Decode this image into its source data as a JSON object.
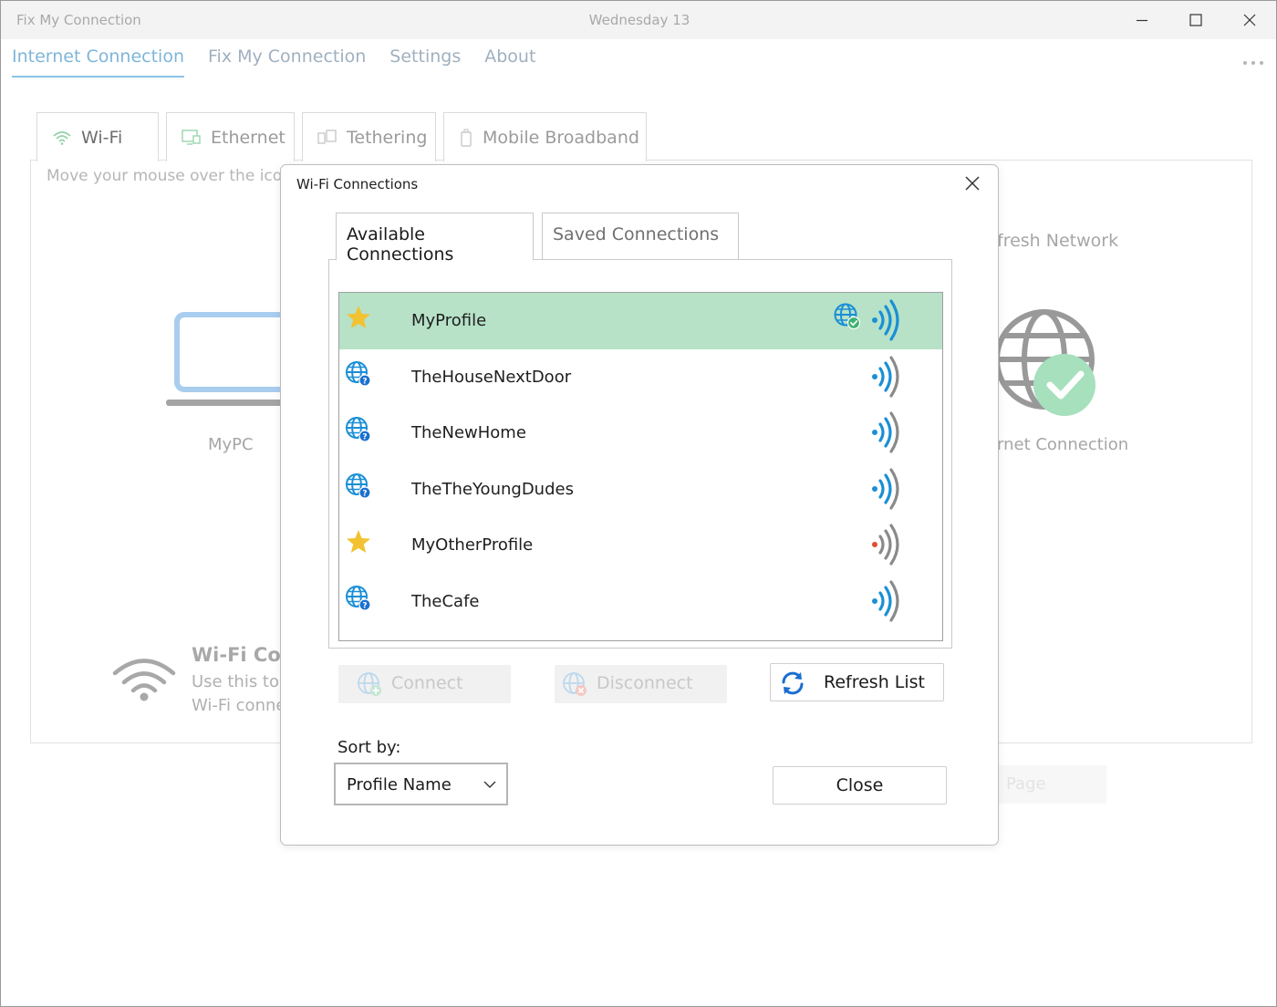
{
  "window": {
    "title": "Fix My Connection",
    "date": "Wednesday 13"
  },
  "nav": {
    "items": [
      {
        "label": "Internet Connection",
        "active": true
      },
      {
        "label": "Fix My Connection",
        "active": false
      },
      {
        "label": "Settings",
        "active": false
      },
      {
        "label": "About",
        "active": false
      }
    ]
  },
  "background": {
    "tabs": [
      {
        "label": "Wi-Fi",
        "icon": "wifi-icon",
        "active": true
      },
      {
        "label": "Ethernet",
        "icon": "ethernet-icon",
        "active": false
      },
      {
        "label": "Tethering",
        "icon": "tethering-icon",
        "active": false
      },
      {
        "label": "Mobile Broadband",
        "icon": "mobile-broadband-icon",
        "active": false
      }
    ],
    "hint": "Move your mouse over the icons",
    "refresh_network_partial": "fresh Network",
    "pc_label": "MyPC",
    "internet_connection_partial": "rnet Connection",
    "wifi_title_partial": "Wi-Fi Cor",
    "wifi_desc_line1_partial": "Use this too",
    "wifi_desc_line2_partial": "Wi-Fi conne",
    "page_button_partial": "Page"
  },
  "dialog": {
    "title": "Wi-Fi Connections",
    "tabs": [
      {
        "label": "Available Connections",
        "active": true
      },
      {
        "label": "Saved Connections",
        "active": false
      }
    ],
    "connections": [
      {
        "name": "MyProfile",
        "icon": "star-icon",
        "selected": true,
        "connected": true,
        "signal": "strong"
      },
      {
        "name": "TheHouseNextDoor",
        "icon": "globe-question-icon",
        "selected": false,
        "connected": false,
        "signal": "strong"
      },
      {
        "name": "TheNewHome",
        "icon": "globe-question-icon",
        "selected": false,
        "connected": false,
        "signal": "strong"
      },
      {
        "name": "TheTheYoungDudes",
        "icon": "globe-question-icon",
        "selected": false,
        "connected": false,
        "signal": "strong"
      },
      {
        "name": "MyOtherProfile",
        "icon": "star-icon",
        "selected": false,
        "connected": false,
        "signal": "weak"
      },
      {
        "name": "TheCafe",
        "icon": "globe-question-icon",
        "selected": false,
        "connected": false,
        "signal": "strong"
      }
    ],
    "buttons": {
      "connect": "Connect",
      "disconnect": "Disconnect",
      "refresh": "Refresh List",
      "close": "Close"
    },
    "sort": {
      "label": "Sort by:",
      "selected": "Profile Name"
    }
  },
  "colors": {
    "selected_row": "#b7e2c8",
    "accent_blue": "#1a8fd6",
    "star": "#f2c232",
    "weak_signal_dot": "#e0502c",
    "ok_green": "#3cb371"
  }
}
